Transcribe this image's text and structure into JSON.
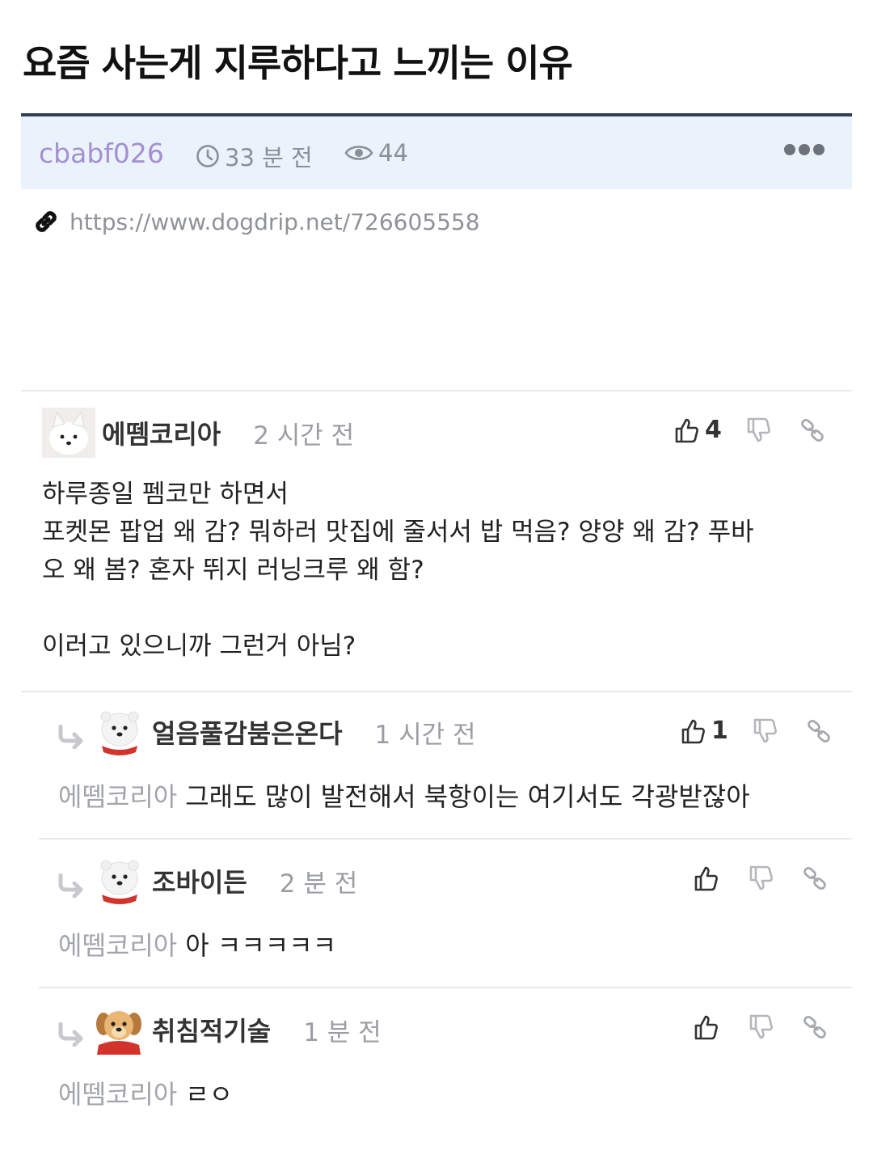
{
  "post": {
    "title": "요즘 사는게 지루하다고 느끼는 이유",
    "author": "cbabf026",
    "time": "33 분 전",
    "views": "44",
    "url": "https://www.dogdrip.net/726605558"
  },
  "comments": [
    {
      "nick": "에뗌코리아",
      "time": "2 시간 전",
      "likes": "4",
      "lines": [
        "하루종일 펨코만 하면서",
        "포켓몬 팝업 왜 감? 뭐하러 맛집에 줄서서 밥 먹음? 양양 왜 감? 푸바",
        "오 왜 봄? 혼자 뛰지 러닝크루 왜 함?",
        "",
        "이러고 있으니까 그런거 아님?"
      ]
    }
  ],
  "replies": [
    {
      "nick": "얼음풀감붐은온다",
      "time": "1 시간 전",
      "likes": "1",
      "mention": "에뗌코리아",
      "text": "그래도 많이 발전해서 북항이는 여기서도 각광받잖아"
    },
    {
      "nick": "조바이든",
      "time": "2 분 전",
      "likes": "",
      "mention": "에뗌코리아",
      "text": "아 ㅋㅋㅋㅋㅋ"
    },
    {
      "nick": "취침적기술",
      "time": "1 분 전",
      "likes": "",
      "mention": "에뗌코리아",
      "text": "ㄹㅇ"
    }
  ],
  "icons": {
    "clock": "clock-icon",
    "views": "eye-icon",
    "more": "more-dots-icon",
    "link": "link-icon",
    "like": "thumbs-up-icon",
    "dislike": "thumbs-down-icon",
    "share": "link-icon",
    "reply": "reply-arrow-icon"
  },
  "colors": {
    "author": "#a48fcf",
    "meta_bg": "#eaf2fc",
    "meta_border": "#2f3f58"
  }
}
